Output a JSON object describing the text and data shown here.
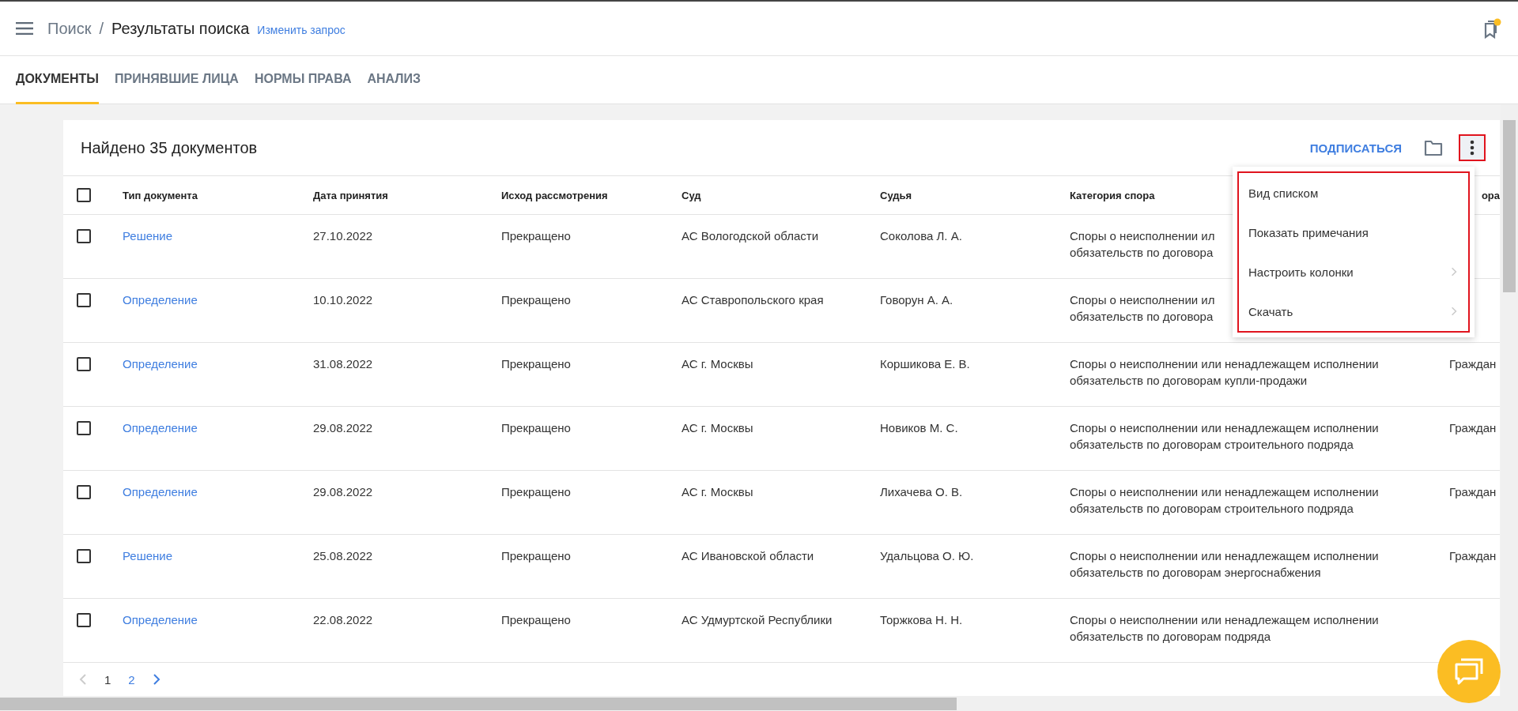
{
  "header": {
    "breadcrumb_parent": "Поиск",
    "separator": "/",
    "title": "Результаты поиска",
    "edit_link": "Изменить запрос",
    "bookmarks_badge": true
  },
  "tabs": [
    {
      "label": "ДОКУМЕНТЫ",
      "selected": true
    },
    {
      "label": "ПРИНЯВШИЕ ЛИЦА",
      "selected": false
    },
    {
      "label": "НОРМЫ ПРАВА",
      "selected": false
    },
    {
      "label": "АНАЛИЗ",
      "selected": false
    }
  ],
  "results": {
    "title": "Найдено 35 документов",
    "subscribe": "ПОДПИСАТЬСЯ",
    "more_button_highlighted": true,
    "select_all_checked": false,
    "columns": [
      "Тип документа",
      "Дата принятия",
      "Исход рассмотрения",
      "Суд",
      "Судья",
      "Категория спора",
      "ора"
    ],
    "rows": [
      {
        "checked": false,
        "type": "Решение",
        "date": "27.10.2022",
        "outcome": "Прекращено",
        "court": "АС Вологодской области",
        "judge": "Соколова Л. А.",
        "category": "Споры о неисполнении ил\nобязательств по договора"
      },
      {
        "checked": false,
        "type": "Определение",
        "date": "10.10.2022",
        "outcome": "Прекращено",
        "court": "АС Ставропольского края",
        "judge": "Говорун А. А.",
        "category": "Споры о неисполнении ил\nобязательств по договора"
      },
      {
        "checked": false,
        "type": "Определение",
        "date": "31.08.2022",
        "outcome": "Прекращено",
        "court": "АС г. Москвы",
        "judge": "Коршикова Е. В.",
        "category": "Споры о неисполнении или ненадлежащем исполнении обязательств по договорам купли-продажи",
        "column_7": "Граждан"
      },
      {
        "checked": false,
        "type": "Определение",
        "date": "29.08.2022",
        "outcome": "Прекращено",
        "court": "АС г. Москвы",
        "judge": "Новиков М. С.",
        "category": "Споры о неисполнении или ненадлежащем исполнении обязательств по договорам строительного подряда",
        "column_7": "Граждан"
      },
      {
        "checked": false,
        "type": "Определение",
        "date": "29.08.2022",
        "outcome": "Прекращено",
        "court": "АС г. Москвы",
        "judge": "Лихачева О. В.",
        "category": "Споры о неисполнении или ненадлежащем исполнении обязательств по договорам строительного подряда",
        "column_7": "Граждан"
      },
      {
        "checked": false,
        "type": "Решение",
        "date": "25.08.2022",
        "outcome": "Прекращено",
        "court": "АС Ивановской области",
        "judge": "Удальцова О. Ю.",
        "category": "Споры о неисполнении или ненадлежащем исполнении обязательств по договорам энергоснабжения",
        "column_7": "Граждан"
      },
      {
        "checked": false,
        "type": "Определение",
        "date": "22.08.2022",
        "outcome": "Прекращено",
        "court": "АС Удмуртской Республики",
        "judge": "Торжкова Н. Н.",
        "category": "Споры о неисполнении или ненадлежащем исполнении обязательств по договорам подряда"
      }
    ],
    "pages": [
      {
        "label": "1",
        "selected": true
      },
      {
        "label": "2",
        "selected": false
      }
    ],
    "prev_disabled": true
  },
  "menu": {
    "highlighted": true,
    "items": [
      {
        "label": "Вид списком",
        "submenu": false
      },
      {
        "label": "Показать примечания",
        "submenu": false
      },
      {
        "label": "Настроить колонки",
        "submenu": true
      },
      {
        "label": "Скачать",
        "submenu": true
      }
    ]
  }
}
